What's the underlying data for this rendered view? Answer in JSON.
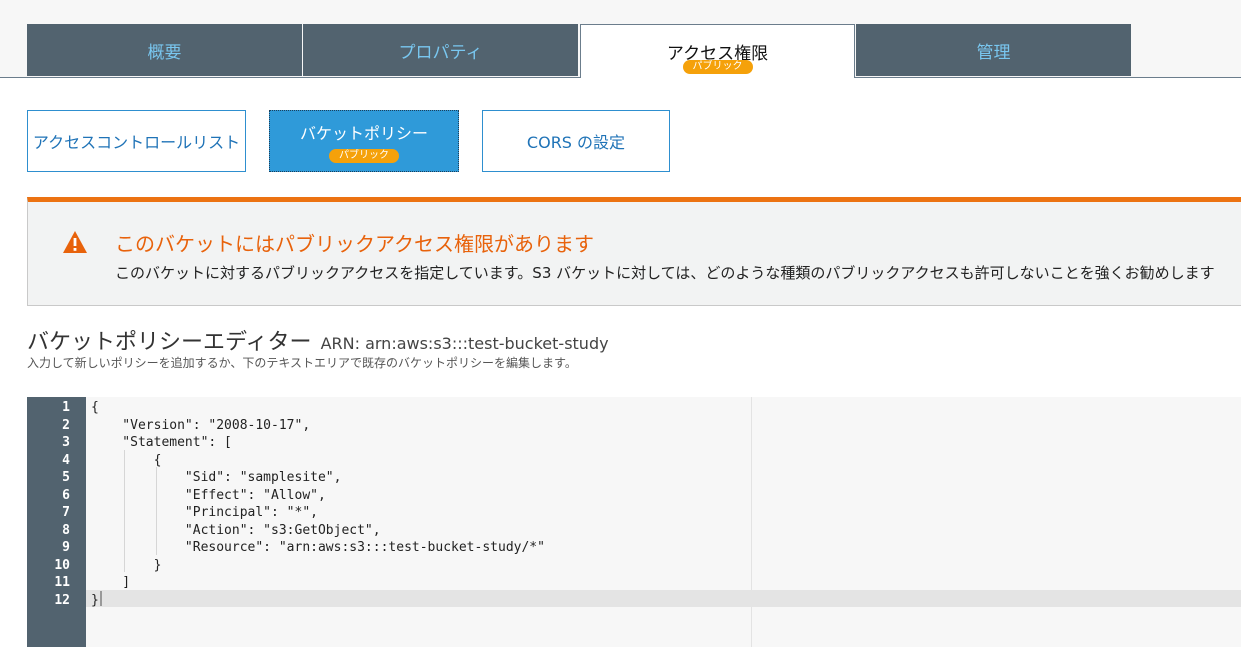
{
  "tabs": [
    {
      "label": "概要",
      "active": false
    },
    {
      "label": "プロパティ",
      "active": false
    },
    {
      "label": "アクセス権限",
      "active": true,
      "badge": "パブリック"
    },
    {
      "label": "管理",
      "active": false
    }
  ],
  "subtabs": [
    {
      "label": "アクセスコントロールリスト",
      "active": false
    },
    {
      "label": "バケットポリシー",
      "active": true,
      "badge": "パブリック"
    },
    {
      "label": "CORS の設定",
      "active": false
    }
  ],
  "warning": {
    "icon": "warning-triangle-icon",
    "title": "このバケットにはパブリックアクセス権限があります",
    "text": "このバケットに対するパブリックアクセスを指定しています。S3 バケットに対しては、どのような種類のパブリックアクセスも許可しないことを強くお勧めします"
  },
  "editor": {
    "title": "バケットポリシーエディター",
    "arn": "ARN: arn:aws:s3:::test-bucket-study",
    "subtitle": "入力して新しいポリシーを追加するか、下のテキストエリアで既存のバケットポリシーを編集します。",
    "lines": [
      {
        "no": "1",
        "text": "{"
      },
      {
        "no": "2",
        "text": "    \"Version\": \"2008-10-17\","
      },
      {
        "no": "3",
        "text": "    \"Statement\": ["
      },
      {
        "no": "4",
        "text": "        {"
      },
      {
        "no": "5",
        "text": "            \"Sid\": \"samplesite\","
      },
      {
        "no": "6",
        "text": "            \"Effect\": \"Allow\","
      },
      {
        "no": "7",
        "text": "            \"Principal\": \"*\","
      },
      {
        "no": "8",
        "text": "            \"Action\": \"s3:GetObject\","
      },
      {
        "no": "9",
        "text": "            \"Resource\": \"arn:aws:s3:::test-bucket-study/*\""
      },
      {
        "no": "10",
        "text": "        }"
      },
      {
        "no": "11",
        "text": "    ]"
      },
      {
        "no": "12",
        "text": "}"
      }
    ]
  },
  "colors": {
    "tab_bg": "#52636f",
    "tab_text": "#79c7f0",
    "badge": "#f5a10a",
    "accent_blue": "#2f9ad9",
    "warning_orange": "#ec7211"
  }
}
